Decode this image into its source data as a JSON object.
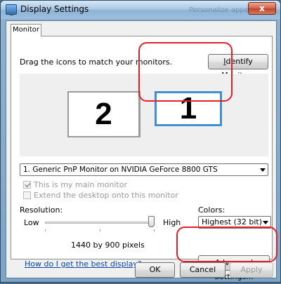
{
  "window": {
    "title": "Display Settings",
    "ghost_text": "Personalize appea...",
    "close_glyph": "x"
  },
  "tabs": [
    {
      "label": "Monitor",
      "active": true
    }
  ],
  "monitor_panel": {
    "instruction": "Drag the icons to match your monitors.",
    "identify_button": "Identify Monitors",
    "monitors": [
      {
        "number": "2",
        "selected": false
      },
      {
        "number": "1",
        "selected": true
      }
    ],
    "monitor_select": "1. Generic PnP Monitor on NVIDIA GeForce 8800 GTS",
    "checkbox_main": {
      "label": "This is my main monitor",
      "checked": true,
      "enabled": false
    },
    "checkbox_extend": {
      "label": "Extend the desktop onto this monitor",
      "checked": false,
      "enabled": false
    },
    "resolution": {
      "label": "Resolution:",
      "low": "Low",
      "high": "High",
      "value": "1440 by 900 pixels",
      "slider_fraction": 1.0
    },
    "colors": {
      "label": "Colors:",
      "value": "Highest (32 bit)"
    },
    "help_link": "How do I get the best display?",
    "advanced_button": "Advanced Settings..."
  },
  "footer": {
    "ok": "OK",
    "cancel": "Cancel",
    "apply": "Apply"
  },
  "colors_theme": {
    "highlight": "#e0202a",
    "selected_monitor_border": "#3e8fd6",
    "link": "#0645ad"
  }
}
